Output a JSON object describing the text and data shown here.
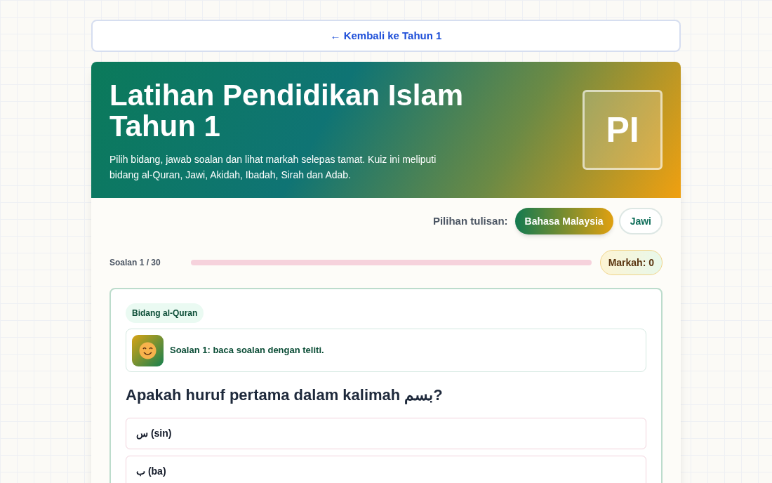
{
  "back_link": "← Kembali ke Tahun 1",
  "hero": {
    "title": "Latihan Pendidikan Islam Tahun 1",
    "description": "Pilih bidang, jawab soalan dan lihat markah selepas tamat. Kuiz ini meliputi bidang al-Quran, Jawi, Akidah, Ibadah, Sirah dan Adab.",
    "badge": "PI"
  },
  "script_choice": {
    "label": "Pilihan tulisan:",
    "options": [
      {
        "label": "Bahasa Malaysia",
        "selected": true
      },
      {
        "label": "Jawi",
        "selected": false
      }
    ]
  },
  "progress": {
    "label": "Soalan 1 / 30",
    "level": 0,
    "score": "Markah: 0"
  },
  "question": {
    "topic": "Bidang al-Quran",
    "hint": "Soalan 1: baca soalan dengan teliti.",
    "text": "Apakah huruf pertama dalam kalimah بسم?",
    "answers": [
      {
        "label": "س (sin)",
        "selected": false
      },
      {
        "label": "ب (ba)",
        "selected": false
      }
    ]
  }
}
